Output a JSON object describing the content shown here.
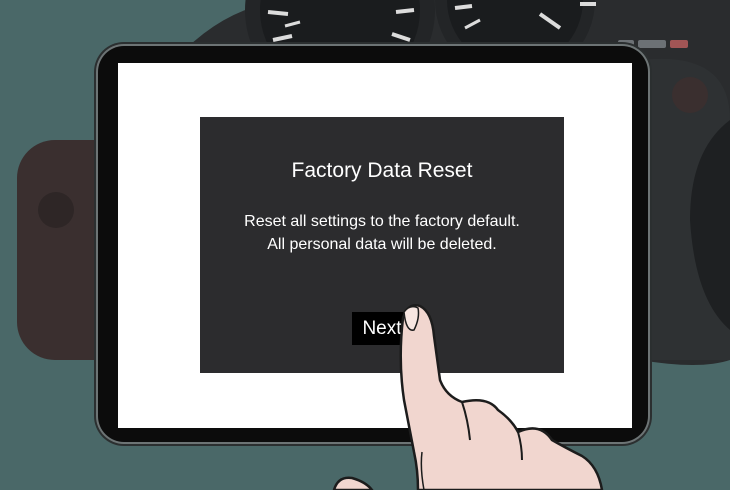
{
  "dialog": {
    "title": "Factory Data Reset",
    "message_line1": "Reset all settings to the factory default.",
    "message_line2": "All personal data will be deleted.",
    "next_label": "Next"
  },
  "colors": {
    "background": "#4a6868",
    "dialog": "#2c2c2e",
    "screen": "#ffffff",
    "button": "#000000"
  }
}
